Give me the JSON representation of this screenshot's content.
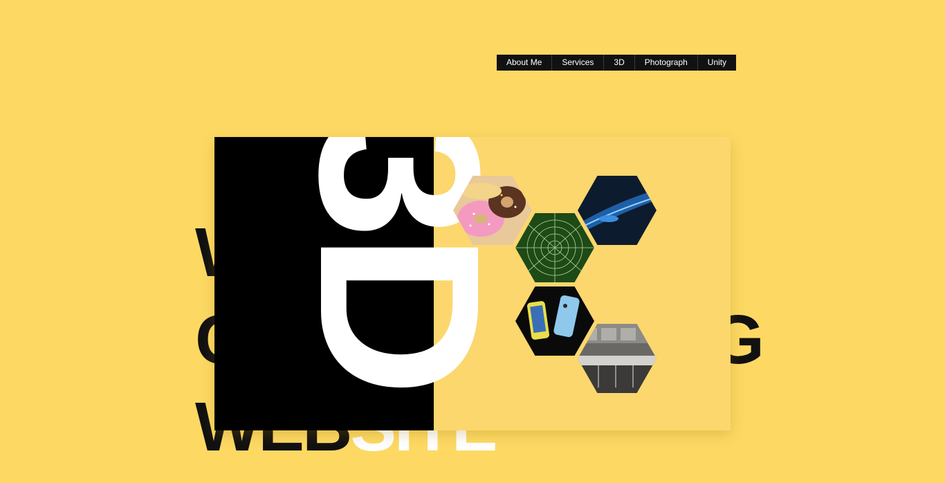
{
  "nav": {
    "items": [
      {
        "label": "About Me"
      },
      {
        "label": "Services"
      },
      {
        "label": "3D"
      },
      {
        "label": "Photograph"
      },
      {
        "label": "Unity"
      }
    ]
  },
  "heading": {
    "line1_left": "W",
    "line2_left": "C",
    "line2_right": "G",
    "line3_dark": "WEB",
    "line3_light": "SITE"
  },
  "card": {
    "badge": "3D",
    "gallery": [
      {
        "name": "donuts",
        "icon": "donuts-image"
      },
      {
        "name": "blue-abstract",
        "icon": "blue-abstract-image"
      },
      {
        "name": "spider-web",
        "icon": "spider-web-image"
      },
      {
        "name": "phones",
        "icon": "phones-image"
      },
      {
        "name": "kitchen",
        "icon": "kitchen-image"
      }
    ]
  },
  "colors": {
    "background": "#fdd964",
    "nav_bg": "#111111",
    "card_black": "#000000",
    "card_right": "#fcd76e",
    "text_dark": "#111111",
    "text_light": "#ffffff"
  }
}
